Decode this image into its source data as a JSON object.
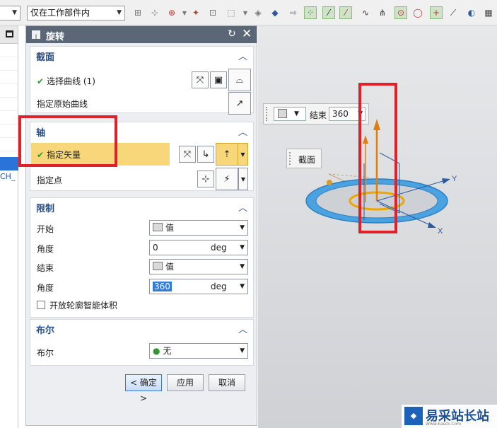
{
  "toolbar": {
    "filter_value": "",
    "scope_value": "仅在工作部件内"
  },
  "tree": {
    "partial_text": "CH_"
  },
  "dialog": {
    "title": "旋转",
    "sections": {
      "section": {
        "title": "截面",
        "select_curve": "选择曲线 (1)",
        "specify_original_curve": "指定原始曲线"
      },
      "axis": {
        "title": "轴",
        "specify_vector": "指定矢量",
        "specify_point": "指定点"
      },
      "limits": {
        "title": "限制",
        "start_label": "开始",
        "start_value": "值",
        "start_angle_label": "角度",
        "start_angle_value": "0",
        "start_angle_unit": "deg",
        "end_label": "结束",
        "end_value": "值",
        "end_angle_label": "角度",
        "end_angle_value": "360",
        "end_angle_unit": "deg",
        "open_profile_label": "开放轮廓智能体积"
      },
      "boolean": {
        "title": "布尔",
        "label": "布尔",
        "value": "无"
      }
    },
    "buttons": {
      "ok": "< 确定 >",
      "apply": "应用",
      "cancel": "取消"
    }
  },
  "viewport": {
    "end_label": "结束",
    "end_value": "360",
    "section_tag": "截面",
    "axis_x": "X",
    "axis_y": "Y"
  },
  "watermark": {
    "name": "易采站长站",
    "url": "Www.Easck.Com"
  },
  "colors": {
    "title_bar": "#5b6777",
    "section_title": "#2a4e86",
    "highlight": "#f7d77a",
    "annotation_red": "#e2202a",
    "ring_blue": "#4aa3e0",
    "ring_orange": "#f0a500"
  }
}
